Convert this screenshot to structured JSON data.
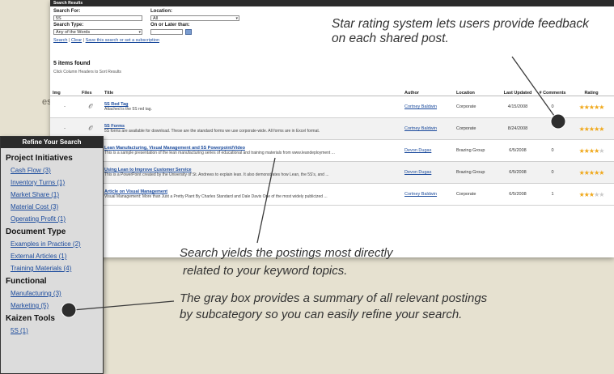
{
  "background_text": "ess",
  "search": {
    "header": "Search Results",
    "search_for_label": "Search For:",
    "search_for_value": "5S",
    "search_type_label": "Search Type:",
    "search_type_value": "Any of the Words",
    "location_label": "Location:",
    "location_value": "All",
    "date_label": "On or Later than:",
    "date_value": "",
    "link_search": "Search",
    "link_clear": "Clear",
    "link_save": "Save this search or set a subscription",
    "sep": "|"
  },
  "results": {
    "found": "5 items found",
    "hint": "Click Column Headers to Sort Results",
    "columns": [
      "Img",
      "Files",
      "Title",
      "Author",
      "Location",
      "Last Updated",
      "# Comments",
      "Rating"
    ],
    "rows": [
      {
        "img": "-",
        "title": "5S Red Tag",
        "desc": "Attached is the 5S red tag.",
        "author": "Cortney Baldwin",
        "location": "Corporate",
        "updated": "4/15/2008",
        "comments": "0",
        "rating": 5
      },
      {
        "img": "-",
        "title": "5S Forms",
        "desc": "5S forms are available for download. These are the standard forms we use corporate-wide. All forms are in Excel format.",
        "author": "Cortney Baldwin",
        "location": "Corporate",
        "updated": "8/24/2008",
        "comments": "",
        "rating": 5
      },
      {
        "img": "-",
        "title": "Lean Manufacturing, Visual Management and 5S Powerpoint/Video",
        "desc": "This is a sample presentation of the lean manufacturing series of educational and training materials from www.leandeployment ...",
        "author": "Devon Dugas",
        "location": "Brazing Group",
        "updated": "6/5/2008",
        "comments": "0",
        "rating": 4
      },
      {
        "img": "-",
        "title": "Using Lean to Improve Customer Service",
        "desc": "This is a PowerPoint created by the University of St. Andrews to explain lean. It also demonstrates how Lean, the 5S's, and ...",
        "author": "Devon Dugas",
        "location": "Brazing Group",
        "updated": "6/5/2008",
        "comments": "0",
        "rating": 5
      },
      {
        "img": "-",
        "title": "Article on Visual Management",
        "desc": "Visual Management: More than Just a Pretty Plant By Charles Standard and Dale Davis One of the most widely publicized ...",
        "author": "Cortney Baldwin",
        "location": "Corporate",
        "updated": "6/5/2008",
        "comments": "1",
        "rating": 3
      }
    ]
  },
  "refine": {
    "title": "Refine Your Search",
    "groups": [
      {
        "name": "Project Initiatives",
        "items": [
          "Cash Flow (3)",
          "Inventory Turns (1)",
          "Market Share (1)",
          "Material Cost (3)",
          "Operating Profit (1)"
        ]
      },
      {
        "name": "Document Type",
        "items": [
          "Examples in Practice (2)",
          "External Articles (1)",
          "Training Materials (4)"
        ]
      },
      {
        "name": "Functional",
        "items": [
          "Manufacturing (3)",
          "Marketing (5)"
        ]
      },
      {
        "name": "Kaizen Tools",
        "items": [
          "5S (1)"
        ]
      }
    ]
  },
  "callouts": {
    "rating": "Star rating system lets users provide feedback on each shared post.",
    "search1": "Search yields the postings most directly",
    "search2": "related to your keyword topics.",
    "gray1": "The gray box provides a summary of all relevant postings",
    "gray2": "by subcategory so you can easily refine your search."
  },
  "colors": {
    "star_on": "#f0a81a",
    "star_off": "#c9c9c9",
    "link": "#1a4a9c",
    "header_bar": "#2b2b2b"
  }
}
